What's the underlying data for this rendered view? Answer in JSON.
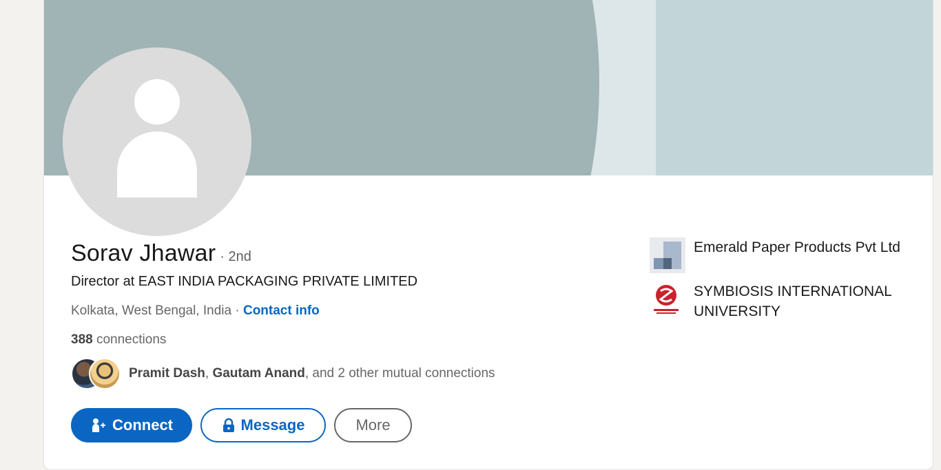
{
  "profile": {
    "name": "Sorav Jhawar",
    "degree": "· 2nd",
    "headline": "Director at EAST INDIA PACKAGING PRIVATE LIMITED",
    "location": "Kolkata, West Bengal, India",
    "location_separator": "·",
    "contact_info_label": "Contact info",
    "connections_count": "388",
    "connections_label": "connections",
    "mutual": {
      "name1": "Pramit Dash",
      "separator": ", ",
      "name2": "Gautam Anand",
      "suffix": ", and 2 other mutual connections"
    }
  },
  "actions": {
    "connect_label": "Connect",
    "message_label": "Message",
    "more_label": "More"
  },
  "experience": [
    {
      "name": "Emerald Paper Products Pvt Ltd",
      "logo": "emerald-logo"
    },
    {
      "name": "SYMBIOSIS INTERNATIONAL UNIVERSITY",
      "logo": "symbiosis-logo"
    }
  ],
  "colors": {
    "accent": "#0a66c2",
    "banner_dark": "#a0b3b5",
    "banner_light": "#c2d5d8"
  }
}
